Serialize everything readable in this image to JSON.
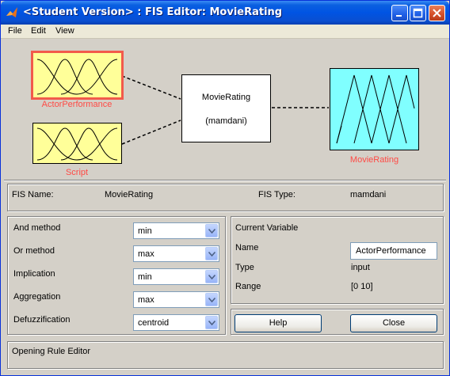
{
  "window": {
    "title": "<Student Version> : FIS Editor: MovieRating",
    "icons": [
      "matlab-logo-icon",
      "minimize-icon",
      "maximize-icon",
      "close-icon"
    ]
  },
  "menu": [
    "File",
    "Edit",
    "View"
  ],
  "diagram": {
    "inputs": [
      {
        "label": "ActorPerformance",
        "selected": true
      },
      {
        "label": "Script",
        "selected": false
      }
    ],
    "system": {
      "name": "MovieRating",
      "type": "(mamdani)"
    },
    "output": {
      "label": "MovieRating"
    }
  },
  "fis_info": {
    "name_label": "FIS Name:",
    "name_value": "MovieRating",
    "type_label": "FIS Type:",
    "type_value": "mamdani"
  },
  "methods": [
    {
      "label": "And method",
      "value": "min"
    },
    {
      "label": "Or method",
      "value": "max"
    },
    {
      "label": "Implication",
      "value": "min"
    },
    {
      "label": "Aggregation",
      "value": "max"
    },
    {
      "label": "Defuzzification",
      "value": "centroid"
    }
  ],
  "current_variable": {
    "title": "Current Variable",
    "name_label": "Name",
    "name_value": "ActorPerformance",
    "type_label": "Type",
    "type_value": "input",
    "range_label": "Range",
    "range_value": "[0 10]"
  },
  "buttons": {
    "help": "Help",
    "close": "Close"
  },
  "status": "Opening Rule Editor",
  "colors": {
    "input_fill": "#ffff99",
    "output_fill": "#80ffff",
    "selection": "#f25a4b",
    "label_red": "#ff4a45",
    "titlebar": "#0054e3"
  }
}
